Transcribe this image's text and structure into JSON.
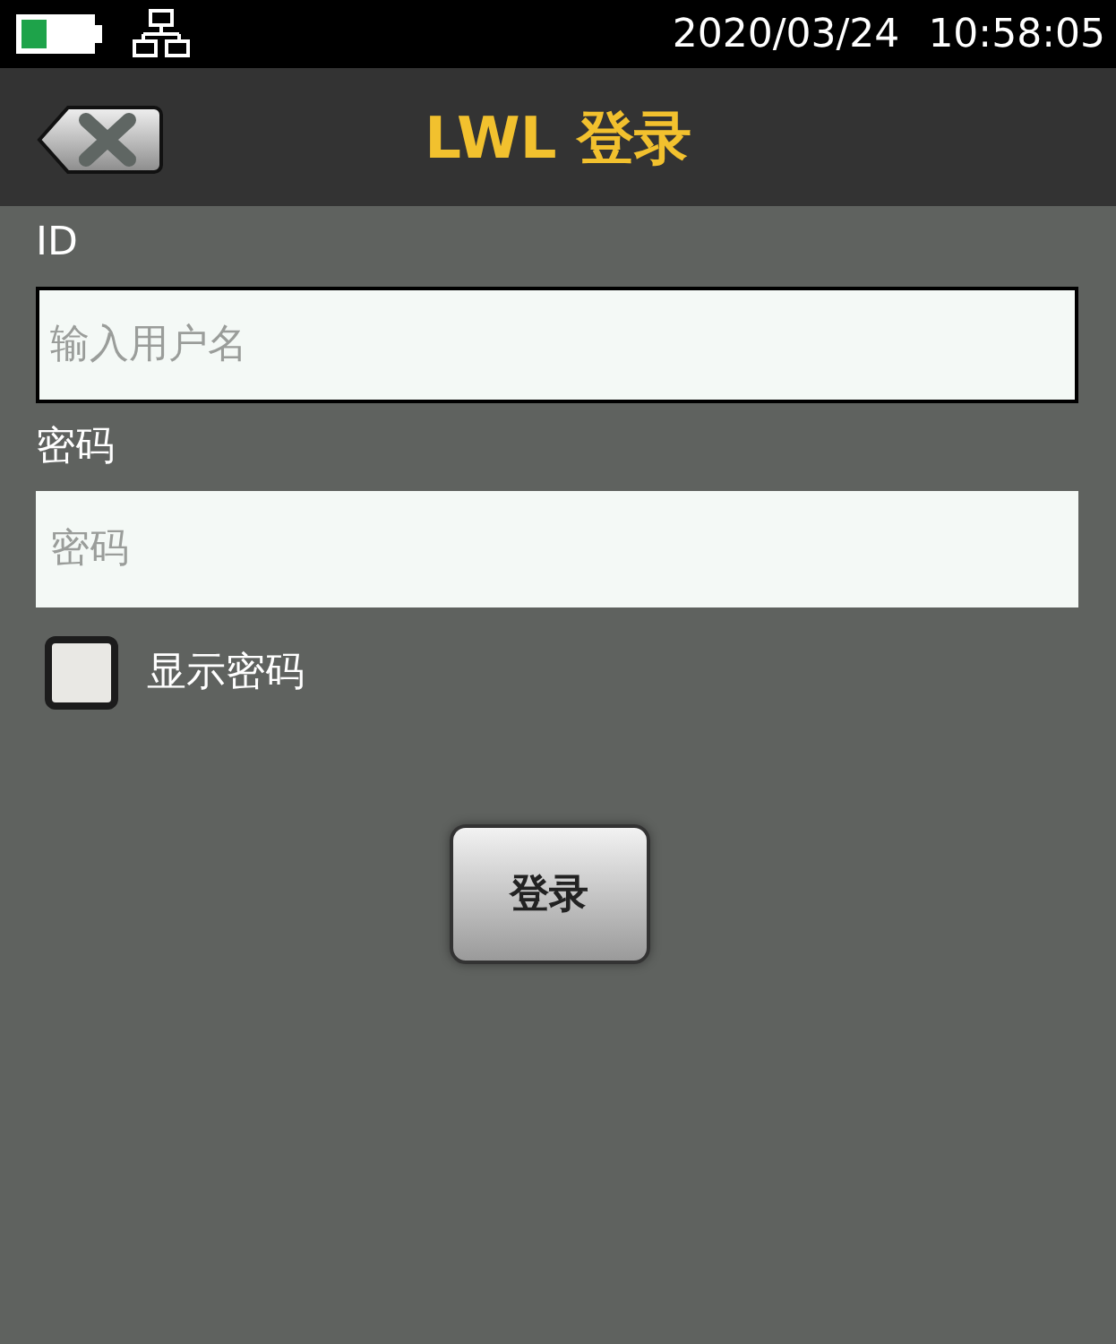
{
  "status_bar": {
    "date": "2020/03/24",
    "time": "10:58:05"
  },
  "header": {
    "title": "LWL 登录"
  },
  "fields": [
    {
      "label": "ID",
      "placeholder": "输入用户名",
      "focused": true
    },
    {
      "label": "密码",
      "placeholder": "密码",
      "focused": false
    }
  ],
  "show_password": {
    "label": "显示密码",
    "checked": false
  },
  "buttons": [
    "登录"
  ]
}
